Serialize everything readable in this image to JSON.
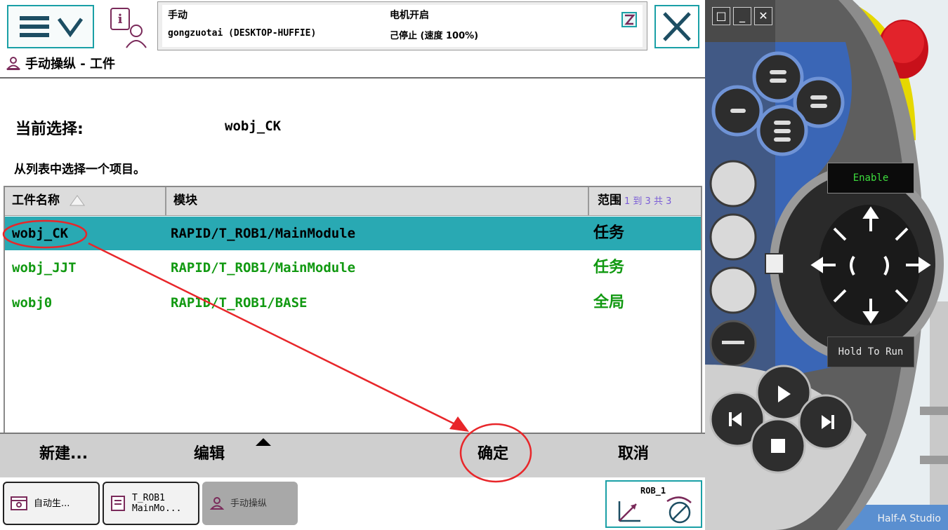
{
  "header": {
    "status_mode": "手动",
    "status_station": "gongzuotai (DESKTOP-HUFFIE)",
    "status_motor": "电机开启",
    "status_state": "己停止 (速度 100%)"
  },
  "breadcrumb": {
    "text": "手动操纵 - 工件"
  },
  "selection": {
    "current_label": "当前选择:",
    "current_value": "wobj_CK",
    "instruction": "从列表中选择一个项目。"
  },
  "table": {
    "columns": {
      "name": "工件名称",
      "module": "模块",
      "scope": "范围"
    },
    "range_info": "1 到 3 共 3",
    "rows": [
      {
        "name": "wobj_CK",
        "module": "RAPID/T_ROB1/MainModule",
        "scope": "任务",
        "selected": true
      },
      {
        "name": "wobj_JJT",
        "module": "RAPID/T_ROB1/MainModule",
        "scope": "任务",
        "selected": false
      },
      {
        "name": "wobj0",
        "module": "RAPID/T_ROB1/BASE",
        "scope": "全局",
        "selected": false
      }
    ]
  },
  "commands": {
    "new": "新建...",
    "edit": "编辑",
    "ok": "确定",
    "cancel": "取消"
  },
  "taskbar": {
    "auto": "自动生...",
    "rapid": "T_ROB1\nMainMo...",
    "jog": "手动操纵",
    "quickset": "ROB_1"
  },
  "pendant": {
    "enable": "Enable",
    "hold_to_run": "Hold To Run",
    "watermark": "Half-A Studio"
  },
  "colors": {
    "accent": "#1aa0a6",
    "selected_row": "#29a9b3",
    "row_text": "#119911",
    "annotation": "#e8262a"
  }
}
